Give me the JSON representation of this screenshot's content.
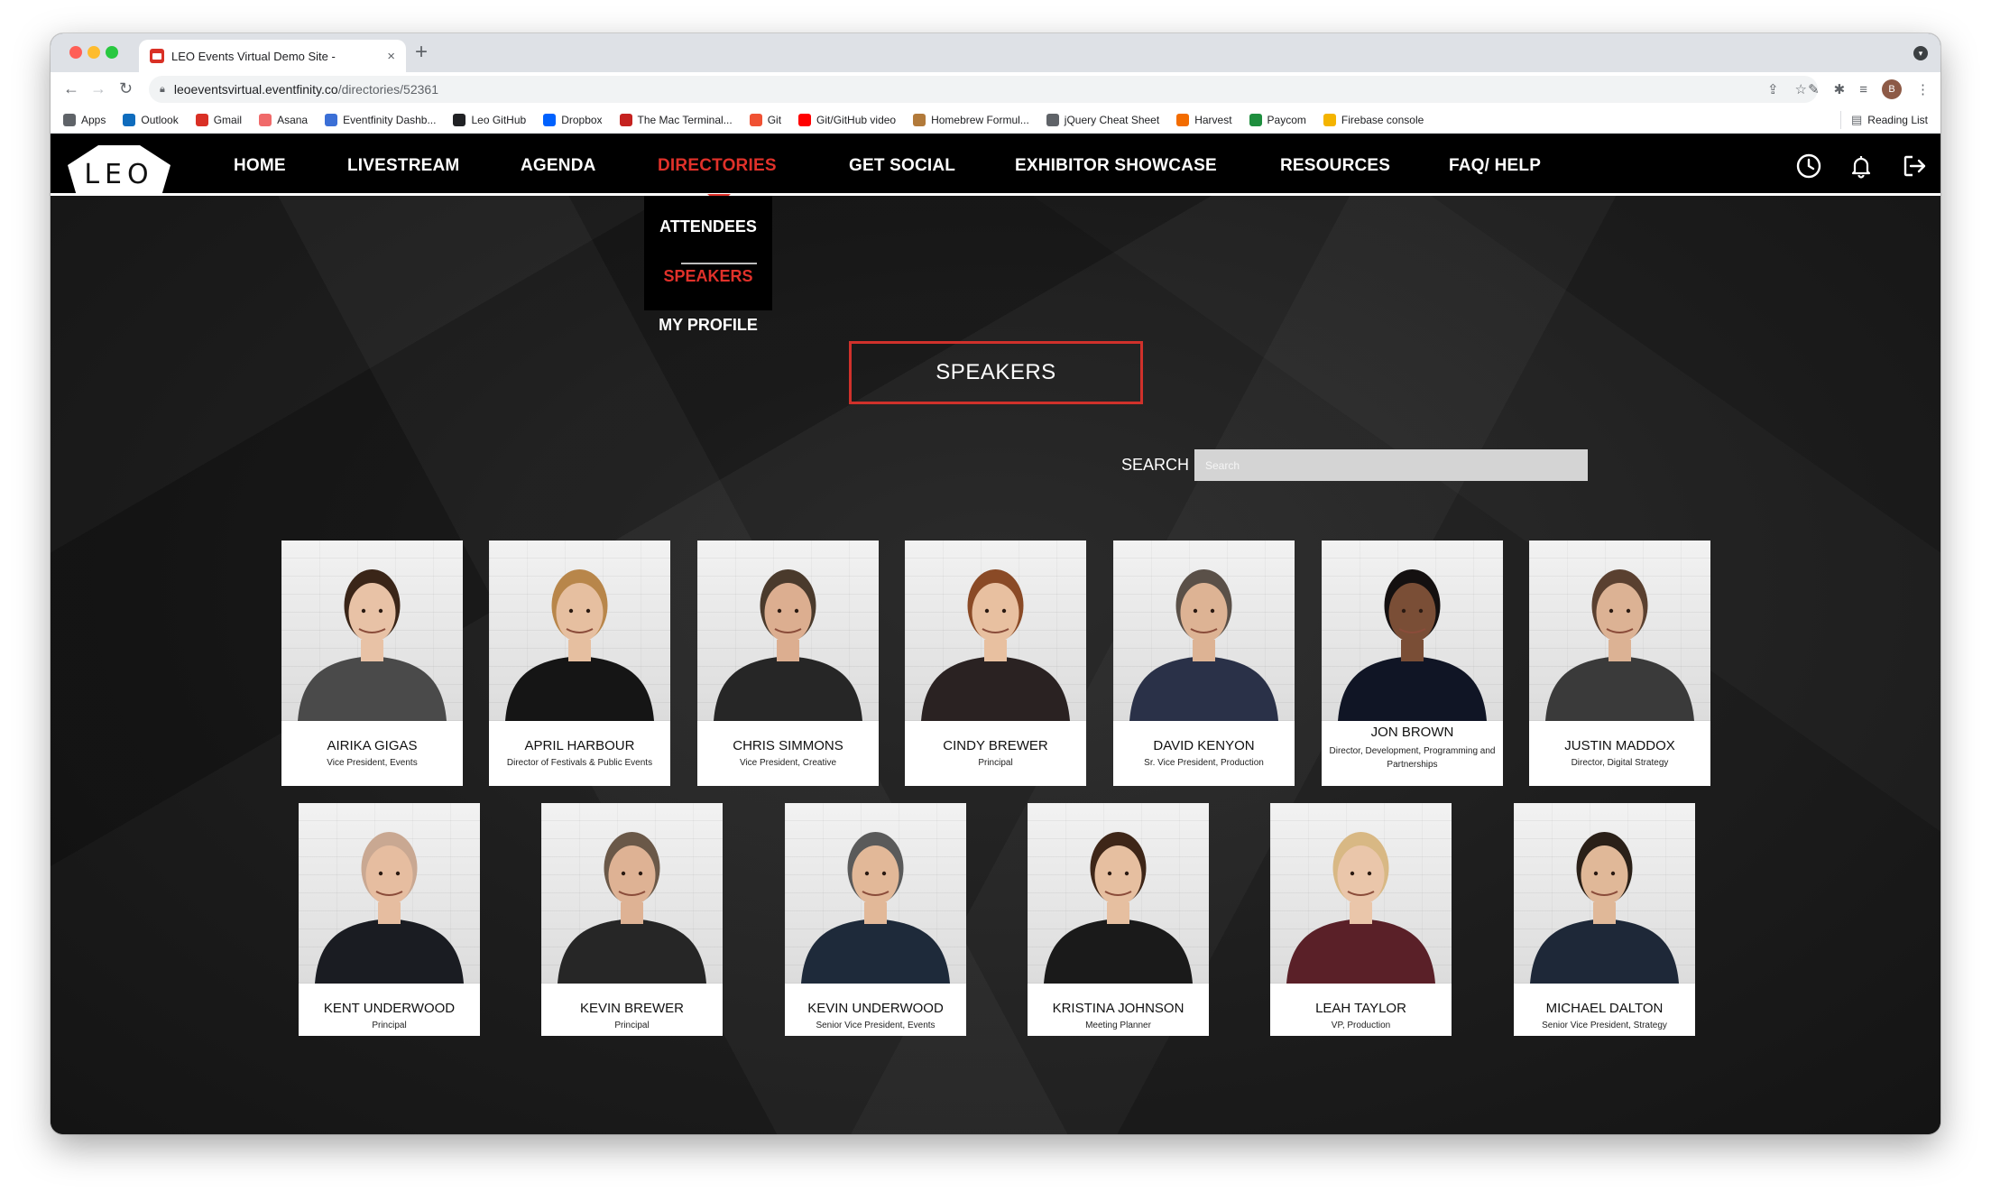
{
  "browser": {
    "tab_title": "LEO Events Virtual Demo Site -",
    "tab_close": "×",
    "new_tab": "+",
    "url_host": "leoeventsvirtual.eventfinity.co",
    "url_path": "/directories/52361",
    "avatar_initial": "B",
    "bookmarks": [
      {
        "label": "Apps",
        "color": "#5f6368"
      },
      {
        "label": "Outlook",
        "color": "#0f6cbd"
      },
      {
        "label": "Gmail",
        "color": "#d93025"
      },
      {
        "label": "Asana",
        "color": "#f06a6a"
      },
      {
        "label": "Eventfinity Dashb...",
        "color": "#3b6fd6"
      },
      {
        "label": "Leo GitHub",
        "color": "#202124"
      },
      {
        "label": "Dropbox",
        "color": "#0061fe"
      },
      {
        "label": "The Mac Terminal...",
        "color": "#c5221f"
      },
      {
        "label": "Git",
        "color": "#f05133"
      },
      {
        "label": "Git/GitHub video",
        "color": "#ff0000"
      },
      {
        "label": "Homebrew Formul...",
        "color": "#b27a3a"
      },
      {
        "label": "jQuery Cheat Sheet",
        "color": "#5f6368"
      },
      {
        "label": "Harvest",
        "color": "#f36c00"
      },
      {
        "label": "Paycom",
        "color": "#1e8e3e"
      },
      {
        "label": "Firebase console",
        "color": "#f4b400"
      }
    ],
    "reading_list": "Reading List"
  },
  "site": {
    "logo": "LEO",
    "nav": [
      {
        "label": "HOME",
        "active": false
      },
      {
        "label": "LIVESTREAM",
        "active": false
      },
      {
        "label": "AGENDA",
        "active": false
      },
      {
        "label": "DIRECTORIES",
        "active": true
      },
      {
        "label": "GET SOCIAL",
        "active": false
      },
      {
        "label": "EXHIBITOR SHOWCASE",
        "active": false
      },
      {
        "label": "RESOURCES",
        "active": false
      },
      {
        "label": "FAQ/ HELP",
        "active": false
      }
    ],
    "nav_icons": [
      "clock-icon",
      "bell-icon",
      "logout-icon"
    ],
    "dropdown": [
      {
        "label": "ATTENDEES",
        "active": false
      },
      {
        "label": "SPEAKERS",
        "active": true
      },
      {
        "label": "MY PROFILE",
        "active": false
      }
    ],
    "accent_color": "#e0312a",
    "page_title": "SPEAKERS",
    "search_label": "SEARCH",
    "search_placeholder": "Search",
    "search_value": ""
  },
  "speakers": [
    {
      "name": "AIRIKA GIGAS",
      "title": "Vice President, Events",
      "hair": "#3a2518",
      "skin": "#e8c2a6",
      "top": "#4a4a4a"
    },
    {
      "name": "APRIL HARBOUR",
      "title": "Director of Festivals & Public Events",
      "hair": "#b8864a",
      "skin": "#e6bfa0",
      "top": "#151515"
    },
    {
      "name": "CHRIS SIMMONS",
      "title": "Vice President, Creative",
      "hair": "#4a3a2c",
      "skin": "#dcae90",
      "top": "#262626"
    },
    {
      "name": "CINDY BREWER",
      "title": "Principal",
      "hair": "#8a4a26",
      "skin": "#e8c0a0",
      "top": "#2a2222"
    },
    {
      "name": "DAVID KENYON",
      "title": "Sr. Vice President, Production",
      "hair": "#5a5048",
      "skin": "#ddb394",
      "top": "#2a3148"
    },
    {
      "name": "JON BROWN",
      "title": "Director, Development, Programming and Partnerships",
      "hair": "#141010",
      "skin": "#7a4e36",
      "top": "#101525"
    },
    {
      "name": "JUSTIN MADDOX",
      "title": "Director, Digital Strategy",
      "hair": "#5a4030",
      "skin": "#dcb294",
      "top": "#3a3a3a"
    },
    {
      "name": "KENT UNDERWOOD",
      "title": "Principal",
      "hair": "#c9a892",
      "skin": "#e6bda0",
      "top": "#1a1c22"
    },
    {
      "name": "KEVIN BREWER",
      "title": "Principal",
      "hair": "#6a5848",
      "skin": "#deb294",
      "top": "#262626"
    },
    {
      "name": "KEVIN UNDERWOOD",
      "title": "Senior Vice President, Events",
      "hair": "#5a5a5a",
      "skin": "#e2b898",
      "top": "#1e2a3a"
    },
    {
      "name": "KRISTINA JOHNSON",
      "title": "Meeting Planner",
      "hair": "#3e2618",
      "skin": "#e6bfa0",
      "top": "#1a1a1a"
    },
    {
      "name": "LEAH TAYLOR",
      "title": "VP, Production",
      "hair": "#d8b884",
      "skin": "#eac6aa",
      "top": "#5a2028"
    },
    {
      "name": "MICHAEL DALTON",
      "title": "Senior Vice President, Strategy",
      "hair": "#2a2018",
      "skin": "#e0b898",
      "top": "#1e2838"
    }
  ]
}
